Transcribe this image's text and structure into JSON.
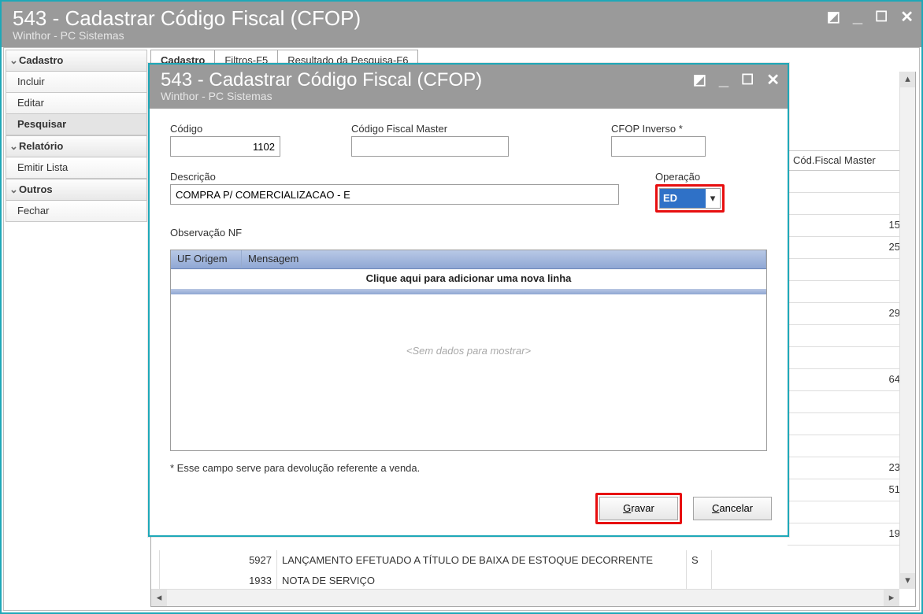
{
  "main": {
    "title": "543 - Cadastrar Código Fiscal (CFOP)",
    "subtitle": "Winthor - PC Sistemas",
    "tabs": [
      "Cadastro",
      "Filtros-F5",
      "Resultado da Pesquisa-F6"
    ]
  },
  "sidebar": {
    "groups": [
      {
        "label": "Cadastro",
        "items": [
          "Incluir",
          "Editar",
          "Pesquisar"
        ],
        "selected": 2
      },
      {
        "label": "Relatório",
        "items": [
          "Emitir Lista"
        ]
      },
      {
        "label": "Outros",
        "items": [
          "Fechar"
        ]
      }
    ]
  },
  "grid": {
    "col_master": "Cód.Fiscal Master",
    "rows_master": [
      "",
      "",
      "15",
      "25",
      "",
      "",
      "29",
      "",
      "",
      "64",
      "",
      "",
      "",
      "23",
      "51",
      "",
      "19"
    ],
    "bottom_rows": [
      {
        "code": "",
        "desc": "",
        "op": ""
      },
      {
        "code": "5927",
        "desc": "LANÇAMENTO EFETUADO A TÍTULO DE BAIXA DE ESTOQUE DECORRENTE",
        "op": "S"
      },
      {
        "code": "1933",
        "desc": "NOTA DE SERVIÇO",
        "op": ""
      }
    ]
  },
  "dialog": {
    "title": "543 - Cadastrar Código Fiscal (CFOP)",
    "subtitle": "Winthor - PC Sistemas",
    "labels": {
      "codigo": "Código",
      "master": "Código Fiscal Master",
      "inverso": "CFOP Inverso *",
      "descricao": "Descrição",
      "operacao": "Operação",
      "obs": "Observação NF",
      "uf": "UF Origem",
      "msg": "Mensagem",
      "add_row": "Clique aqui para adicionar uma nova linha",
      "empty": "<Sem dados para mostrar>",
      "foot": "* Esse campo serve para devolução referente a venda.",
      "gravar": "Gravar",
      "cancelar": "Cancelar"
    },
    "values": {
      "codigo": "1102",
      "master": "",
      "inverso": "",
      "descricao": "COMPRA P/ COMERCIALIZACAO - E",
      "operacao": "ED"
    }
  }
}
